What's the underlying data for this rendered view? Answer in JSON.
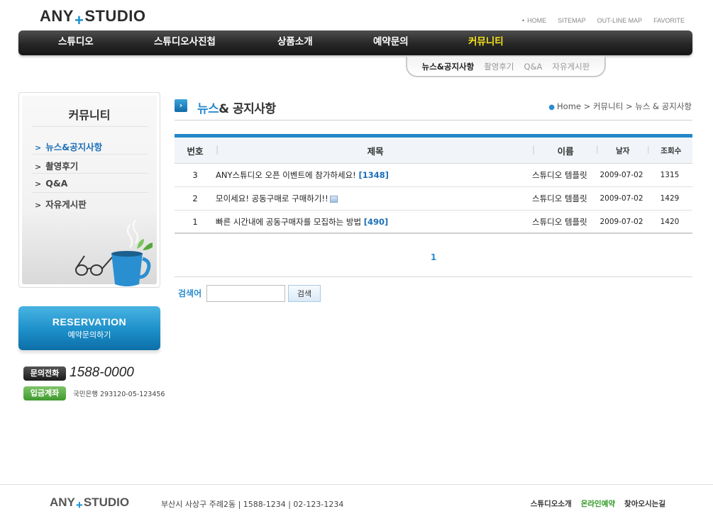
{
  "header": {
    "logo_left": "ANY",
    "logo_plus": "+",
    "logo_right": "STUDIO",
    "util_links": [
      "HOME",
      "SITEMAP",
      "OUT-LINE MAP",
      "FAVORITE"
    ]
  },
  "gnb": [
    "스튜디오",
    "스튜디오사진첩",
    "상품소개",
    "예약문의",
    "커뮤니티"
  ],
  "lnb": [
    "뉴스&공지사항",
    "촬영후기",
    "Q&A",
    "자유게시판"
  ],
  "sidebar": {
    "title": "커뮤니티",
    "items": [
      "뉴스&공지사항",
      "촬영후기",
      "Q&A",
      "자유게시판"
    ]
  },
  "reservation": {
    "title": "RESERVATION",
    "subtitle": "예약문의하기"
  },
  "contact": {
    "phone_label": "문의전화",
    "phone": "1588-0000",
    "account_label": "입금계좌",
    "account": "국민은행 293120-05-123456"
  },
  "page": {
    "title_blue": "뉴스",
    "title_rest": "& 공지사항",
    "breadcrumb": [
      "Home",
      "커뮤니티",
      "뉴스 & 공지사항"
    ]
  },
  "board": {
    "columns": [
      "번호",
      "제목",
      "이름",
      "날자",
      "조회수"
    ],
    "rows": [
      {
        "no": "3",
        "title": "ANY스튜디오 오픈 이벤트에 참가하세요!",
        "count": "[1348]",
        "name": "스튜디오 템플릿",
        "date": "2009-07-02",
        "hits": "1315"
      },
      {
        "no": "2",
        "title": "모이세요! 공동구매로 구매하기!!",
        "count": "",
        "name": "스튜디오 템플릿",
        "date": "2009-07-02",
        "hits": "1429"
      },
      {
        "no": "1",
        "title": "빠른 시간내에 공동구매자를 모집하는 방법",
        "count": "[490]",
        "name": "스튜디오 템플릿",
        "date": "2009-07-02",
        "hits": "1420"
      }
    ]
  },
  "pager": {
    "current": "1"
  },
  "search": {
    "label": "검색어",
    "value": "",
    "button": "검색"
  },
  "footer": {
    "logo_left": "ANY",
    "logo_plus": "+",
    "logo_right": "STUDIO",
    "address": "부산시 사상구 주례2동 | 1588-1234 | 02-123-1234",
    "links": [
      "스튜디오소개",
      "온라인예약",
      "찾아오시는길"
    ]
  },
  "colors": {
    "accent": "#2488c8",
    "active_menu": "#f3e21c",
    "green": "#2d9a22"
  }
}
